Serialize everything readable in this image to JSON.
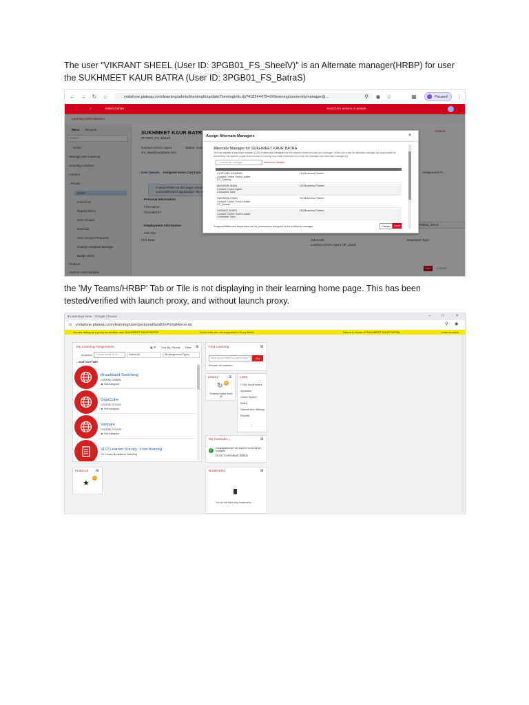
{
  "paragraph1": "The user \"VIKRANT SHEEL (User ID: 3PGB01_FS_SheelV)\" is an Alternate manager(HRBP) for user the SUKHMEET KAUR BATRA (User ID: 3PGB01_FS_BatraS)",
  "paragraph2": "the 'My Teams/HRBP' Tab or Tile is not displaying in their learning home page. This has been tested/verified with launch proxy, and without launch proxy.",
  "screenshot1": {
    "url": "vodafone.plateau.com/learning/admin/themingfo/updateThemingInfo.do?410244479=0#/learning/userentitymanager@...",
    "profile_badge": "Paused",
    "profile_initial": "S",
    "brand": "Admin Centre",
    "search_placeholder": "Search for actions or people",
    "section_title": "Learning Administration",
    "sidebar": {
      "tabs": [
        "Menu",
        "Recents"
      ],
      "search": "Search",
      "items": [
        "Home",
        "Manage User Learning",
        "Learning Activities",
        "Content",
        "People",
        "Users",
        "Instructors",
        "Organizations",
        "User Groups",
        "Curricula",
        "User Account Requests",
        "Change Assigned Manager",
        "Badge Users",
        "Finance",
        "System Administration"
      ]
    },
    "user_header": {
      "name": "SUKHMEET KAUR BATRA",
      "user_id": "3PGB01_FS_BatraS",
      "actions": "Actions"
    },
    "detail_fields": [
      "Contact Centre Agent",
      "sm_kaur@vodafone.com",
      "Status: Active",
      "Job Code:",
      "Contact Centre Agent (JP_2031)",
      "Employee Type:",
      "RM_3PGB01_DSV4",
      "Hire Date:",
      "SP_SMSC (SP_SMSC)"
    ],
    "sub_tabs": [
      "User Details",
      "Assigned Items",
      "Curricula"
    ],
    "assignment_profile": "Assignment Pr...",
    "info_banner": "Custom fields on this page remain editable...",
    "info_banner_2": "SuccessFactors application, the ev...",
    "personal_info": "Personal Information",
    "first_name_label": "First Name:",
    "first_name_value": "SUKHMEET",
    "employment_info": "Employment Information",
    "job_title_label": "Job Title:",
    "hire_label": "Hire Date:",
    "bottom_buttons": [
      "Save",
      "Cancel"
    ],
    "modal": {
      "title": "Assign Alternate Managers",
      "heading": "Alternate Manager for SUKHMEET KAUR BATRA",
      "description": "You can identify a maximum number (100) of alternate managers for the desired linked records who manager. When you track an alternate manager as responsible for something, the system copies that involved in having any email notifications to both the manager and alternate manager(s).",
      "add_placeholder": "Choose an manager",
      "advanced_search": "Advanced Search",
      "rows": [
        {
          "name": "CLIFFORD KHAIRAN",
          "title": "Contact Centre Team Leader",
          "org": "FS_Training",
          "role": "HO Business Partner"
        },
        {
          "name": "MUDASIR SHAH",
          "title": "Contact Centre Agent",
          "org": "Consumer Care",
          "role": "HO Business Partner"
        },
        {
          "name": "RAHADHA ZHAN",
          "title": "Contact Centre Team Leader",
          "org": "FS_Quality",
          "role": "HO Business Partner"
        },
        {
          "name": "VIKRANT SHEEL",
          "title": "Contact Centre Team Leader",
          "org": "Consumer Care",
          "role": "HO Business Partner"
        }
      ],
      "footnote": "Responsibilities are dependent on the permissions assigned to the individual manager.",
      "cancel": "Cancel",
      "save": "Save"
    }
  },
  "screenshot2": {
    "window_title": "Learning Home - Google Chrome",
    "url": "vodafone.plateau.com/learning/user/personal/landOnPortalHome.do",
    "proxy_left": "You are acting as a proxy for another user SUKHMEET KAUR BATRA",
    "proxy_mid": "Some links are not supported in Proxy Mode",
    "proxy_right": "Return to Home of SUKHMEET KAUR BATRA",
    "proxy_far": "Learn Account",
    "assignments": {
      "title": "My Learning Assignments",
      "sort": "Sort By: Priority",
      "filter": "Filter",
      "keyword_label": "Keyword",
      "keyword_placeholder": "Course name or ID",
      "select_all": "Select All",
      "assignment_types": "All assignment Types",
      "group": "DUE ANYTIME",
      "items": [
        {
          "title": "Broadband Switching",
          "code": "COURSE 0094891",
          "status": "Self-Assigned"
        },
        {
          "title": "GigaCube",
          "code": "COURSE 0071091",
          "status": "Self-Assigned"
        },
        {
          "title": "Vampire",
          "code": "COURSE 0271030",
          "status": "Self-Assigned"
        },
        {
          "title": "VLO Learner Survey : Live training",
          "code": "For Course Broadband Switching",
          "status": ""
        }
      ]
    },
    "find_learning": {
      "title": "Find Learning",
      "placeholder": "What do you want to Learn today?",
      "go": "Go",
      "browse": "Browse all courses"
    },
    "history": {
      "title": "History",
      "badge": "26",
      "caption": "Recently Added Items (0)"
    },
    "links": {
      "title": "Links",
      "items": [
        "IT My SuccFactors",
        "Applause",
        "Check System",
        "Rated",
        "Options and Settings",
        "Reports"
      ]
    },
    "curricula": {
      "title": "My Curricula",
      "message": "Congratulations!!! All required curricula are complete.",
      "link": "Go to Curriculum Status"
    },
    "featured": {
      "title": "Featured",
      "badge": "0"
    },
    "bookmarks": {
      "title": "Bookmarks",
      "empty": "You do not have any bookmarks."
    }
  }
}
